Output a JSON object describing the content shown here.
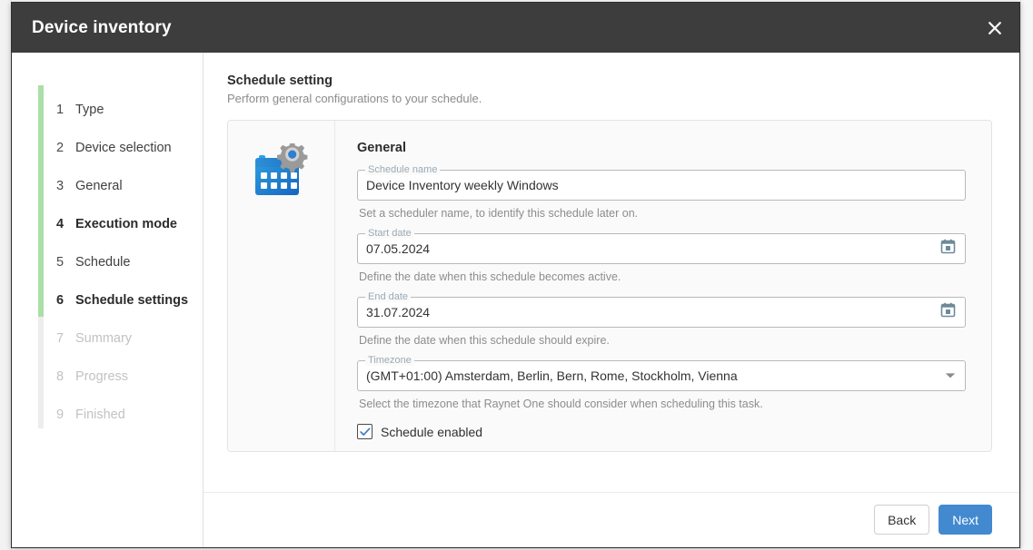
{
  "dialog": {
    "title": "Device inventory",
    "close_label": "Close"
  },
  "stepper": {
    "steps": [
      {
        "number": "1",
        "label": "Type",
        "state": "done"
      },
      {
        "number": "2",
        "label": "Device selection",
        "state": "done"
      },
      {
        "number": "3",
        "label": "General",
        "state": "done"
      },
      {
        "number": "4",
        "label": "Execution mode",
        "state": "active"
      },
      {
        "number": "5",
        "label": "Schedule",
        "state": "done"
      },
      {
        "number": "6",
        "label": "Schedule settings",
        "state": "active"
      },
      {
        "number": "7",
        "label": "Summary",
        "state": "disabled"
      },
      {
        "number": "8",
        "label": "Progress",
        "state": "disabled"
      },
      {
        "number": "9",
        "label": "Finished",
        "state": "disabled"
      }
    ],
    "progress_color": "#aadfa6",
    "rail_color": "#ededed"
  },
  "page": {
    "title": "Schedule setting",
    "subtitle": "Perform general configurations to your schedule."
  },
  "card": {
    "icon_name": "calendar-settings-icon",
    "form_title": "General",
    "fields": {
      "schedule_name": {
        "label": "Schedule name",
        "value": "Device Inventory weekly Windows",
        "placeholder": "Schedule name",
        "helper": "Set a scheduler name, to identify this schedule later on."
      },
      "start_date": {
        "label": "Start date",
        "value": "07.05.2024",
        "placeholder": "Start date",
        "helper": "Define the date when this schedule becomes active.",
        "trailing_icon": "calendar-icon"
      },
      "end_date": {
        "label": "End date",
        "value": "31.07.2024",
        "placeholder": "End date",
        "helper": "Define the date when this schedule should expire.",
        "trailing_icon": "calendar-icon"
      },
      "timezone": {
        "label": "Timezone",
        "value": "(GMT+01:00) Amsterdam, Berlin, Bern, Rome, Stockholm, Vienna",
        "helper": "Select the timezone that Raynet One should consider when scheduling this task.",
        "trailing_icon": "chevron-down-icon"
      }
    },
    "schedule_enabled": {
      "label": "Schedule enabled",
      "checked": true,
      "check_color": "#3d7fc4"
    }
  },
  "footer": {
    "back_label": "Back",
    "next_label": "Next",
    "primary_color": "#4289d0"
  }
}
